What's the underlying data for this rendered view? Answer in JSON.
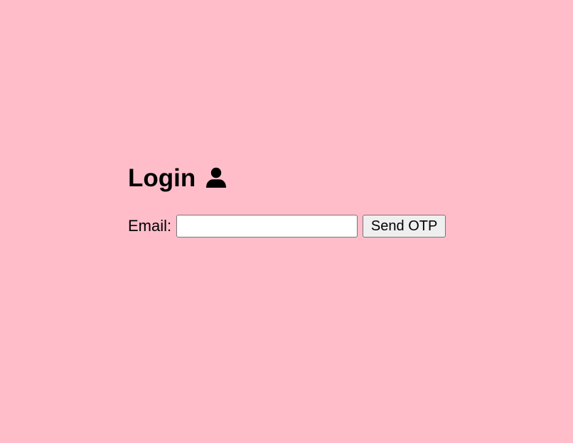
{
  "page": {
    "background_color": "#ffbdca"
  },
  "login": {
    "title": "Login",
    "title_icon": "user-icon",
    "email_label": "Email:",
    "email_value": "",
    "email_placeholder": "",
    "send_button_label": "Send OTP"
  }
}
